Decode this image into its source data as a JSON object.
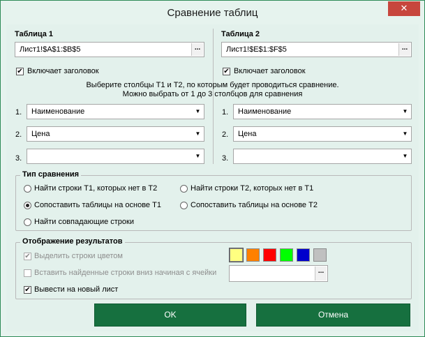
{
  "window": {
    "title": "Сравнение таблиц",
    "close_label": "✕"
  },
  "table1": {
    "label": "Таблица 1",
    "range": "Лист1!$A$1:$B$5",
    "range_button": "...",
    "has_header_label": "Включает заголовок",
    "has_header_checked": true,
    "columns": [
      {
        "num": "1.",
        "value": "Наименование"
      },
      {
        "num": "2.",
        "value": "Цена"
      },
      {
        "num": "3.",
        "value": ""
      }
    ]
  },
  "table2": {
    "label": "Таблица 2",
    "range": "Лист1!$E$1:$F$5",
    "range_button": "...",
    "has_header_label": "Включает заголовок",
    "has_header_checked": true,
    "columns": [
      {
        "num": "1.",
        "value": "Наименование"
      },
      {
        "num": "2.",
        "value": "Цена"
      },
      {
        "num": "3.",
        "value": ""
      }
    ]
  },
  "instructions": {
    "line1": "Выберите столбцы Т1 и Т2, по которым будет проводиться сравнение.",
    "line2": "Можно выбрать от  1 до 3 столбцов для сравнения"
  },
  "compare_type": {
    "title": "Тип сравнения",
    "options": {
      "missing_in_t2": "Найти строки Т1, которых нет в Т2",
      "missing_in_t1": "Найти строки Т2, которых нет в Т1",
      "match_by_t1": "Сопоставить таблицы на основе Т1",
      "match_by_t2": "Сопоставить таблицы на основе Т2",
      "find_matching": "Найти совпадающие строки"
    },
    "selected": "match_by_t1"
  },
  "results": {
    "title": "Отображение результатов",
    "highlight_label": "Выделить строки цветом",
    "insert_label": "Вставить найденные строки вниз начиная с ячейки",
    "insert_cell_value": "",
    "insert_button": "...",
    "new_sheet_label": "Вывести на новый лист",
    "new_sheet_checked": true,
    "colors": [
      "#ffff80",
      "#ff8000",
      "#ff0000",
      "#00ff00",
      "#0000cc",
      "#c0c0c0"
    ]
  },
  "buttons": {
    "ok": "OK",
    "cancel": "Отмена"
  },
  "icons": {
    "dropdown": "▼",
    "check": "✔"
  }
}
